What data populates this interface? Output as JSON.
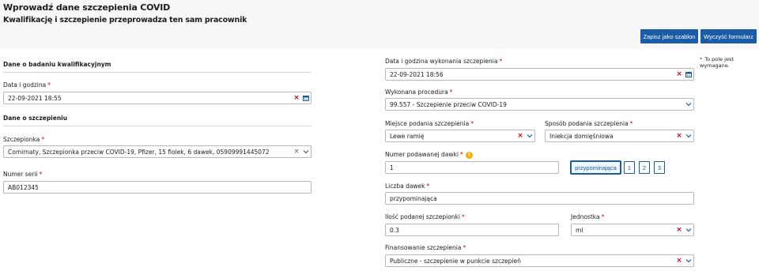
{
  "header": {
    "title": "Wprowadź dane szczepienia COVID",
    "subtitle": "Kwalifikację i szczepienie przeprowadza ten sam pracownik",
    "save_template_label": "Zapisz jako szablon",
    "clear_form_label": "Wyczyść formularz"
  },
  "required_mark": "*",
  "required_note": "To pole jest wymagane.",
  "left": {
    "qualification_section": "Dane o badaniu kwalifikacyjnym",
    "qual_datetime_label": "Data i godzina",
    "qual_datetime_value": "22-09-2021 18:55",
    "vaccination_section": "Dane o szczepieniu",
    "vaccine_label": "Szczepionka",
    "vaccine_value": "Comirnaty, Szczepionka przeciw COVID-19, Pfizer, 15 fiolek, 6 dawek, 05909991445072",
    "serial_label": "Numer serii",
    "serial_value": "AB012345"
  },
  "right": {
    "vacc_datetime_label": "Data i godzina wykonania szczepienia",
    "vacc_datetime_value": "22-09-2021 18:56",
    "procedure_label": "Wykonana procedura",
    "procedure_value": "99.557 - Szczepienie przeciw COVID-19",
    "site_label": "Miejsce podania szczepienia",
    "site_value": "Lewe ramię",
    "method_label": "Sposób podania szczepienia",
    "method_value": "Iniekcja domięśniowa",
    "dose_number_label": "Numer podawanej dawki",
    "dose_number_value": "1",
    "dose_buttons": [
      "przypominająca",
      "1",
      "2",
      "3"
    ],
    "dose_count_label": "Liczba dawek",
    "dose_count_value": "przypominająca",
    "amount_label": "Ilość podanej szczepionki",
    "amount_value": "0.3",
    "unit_label": "Jednostka",
    "unit_value": "ml",
    "funding_label": "Finansowanie szczepienia",
    "funding_value": "Publiczne - szczepienie w punkcie szczepień"
  },
  "icons": {
    "clear": "×",
    "chevron": "chevron-down-icon",
    "calendar": "calendar-icon",
    "help": "?"
  },
  "colors": {
    "primary": "#1a5ca8",
    "required": "#d0021b",
    "help": "#f0b400"
  }
}
